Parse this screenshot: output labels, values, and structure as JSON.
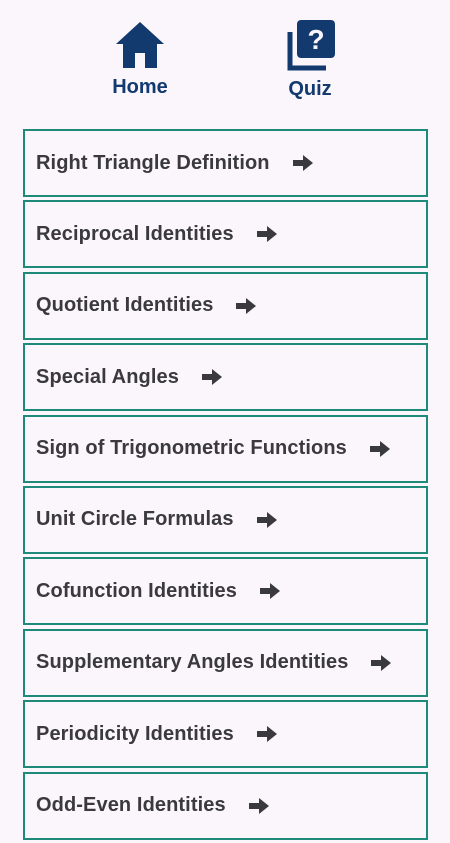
{
  "nav": {
    "home_label": "Home",
    "quiz_label": "Quiz",
    "icon_color": "#123a6e"
  },
  "topics": [
    {
      "label": "Right Triangle Definition",
      "icon": "arrow-right-icon"
    },
    {
      "label": "Reciprocal Identities",
      "icon": "arrow-right-icon"
    },
    {
      "label": "Quotient Identities",
      "icon": "arrow-right-icon"
    },
    {
      "label": "Special Angles",
      "icon": "arrow-right-icon"
    },
    {
      "label": "Sign of Trigonometric Functions",
      "icon": "arrow-right-icon"
    },
    {
      "label": "Unit Circle Formulas",
      "icon": "arrow-right-icon"
    },
    {
      "label": "Cofunction Identities",
      "icon": "arrow-right-icon"
    },
    {
      "label": "Supplementary Angles Identities",
      "icon": "arrow-right-icon"
    },
    {
      "label": "Periodicity Identities",
      "icon": "arrow-right-icon"
    },
    {
      "label": "Odd-Even Identities",
      "icon": "arrow-right-icon"
    }
  ],
  "colors": {
    "background": "#fbf6fc",
    "border": "#1e8a7a",
    "text": "#3a3a3d",
    "nav": "#123a6e"
  }
}
